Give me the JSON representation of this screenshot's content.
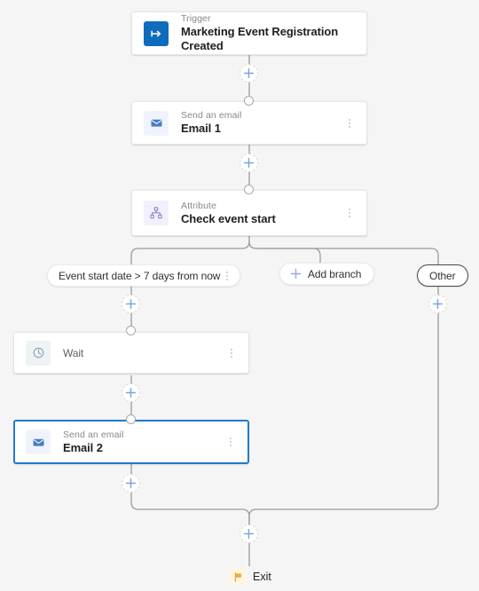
{
  "canvas": {
    "background": "#f5f5f5",
    "accent": "#0f6cbd",
    "plus_color": "#7aa7e0",
    "selected_border": "#1f7bd0"
  },
  "nodes": [
    {
      "id": "trigger",
      "subtitle": "Trigger",
      "title": "Marketing Event Registration Created",
      "icon": "trigger-bolt-icon",
      "icon_bg": "#0f6cbd",
      "icon_fg": "#ffffff",
      "has_kebab": false,
      "selected": false
    },
    {
      "id": "email-1",
      "subtitle": "Send an email",
      "title": "Email 1",
      "icon": "envelope-icon",
      "icon_bg": "#eff4fc",
      "icon_fg": "#4b7bc4",
      "has_kebab": true,
      "selected": false
    },
    {
      "id": "attribute",
      "subtitle": "Attribute",
      "title": "Check event start",
      "icon": "hierarchy-icon",
      "icon_bg": "#f2f1fb",
      "icon_fg": "#8b86cf",
      "has_kebab": true,
      "selected": false
    },
    {
      "id": "wait",
      "subtitle": "",
      "title": "Wait",
      "icon": "clock-icon",
      "icon_bg": "#eef3f5",
      "icon_fg": "#8ea3ad",
      "has_kebab": true,
      "selected": false
    },
    {
      "id": "email-2",
      "subtitle": "Send an email",
      "title": "Email 2",
      "icon": "envelope-icon",
      "icon_bg": "#eff4fc",
      "icon_fg": "#4b7bc4",
      "has_kebab": true,
      "selected": true
    }
  ],
  "branches": {
    "condition_label": "Event start date > 7 days from now",
    "add_branch_label": "Add branch",
    "other_label": "Other"
  },
  "exit": {
    "label": "Exit",
    "icon": "flag-icon"
  },
  "plus_buttons": [
    {
      "id": "plus-after-trigger"
    },
    {
      "id": "plus-after-email-1"
    },
    {
      "id": "plus-left-branch-top"
    },
    {
      "id": "plus-right-branch-top"
    },
    {
      "id": "plus-after-wait"
    },
    {
      "id": "plus-after-email-2"
    },
    {
      "id": "plus-before-exit"
    }
  ]
}
